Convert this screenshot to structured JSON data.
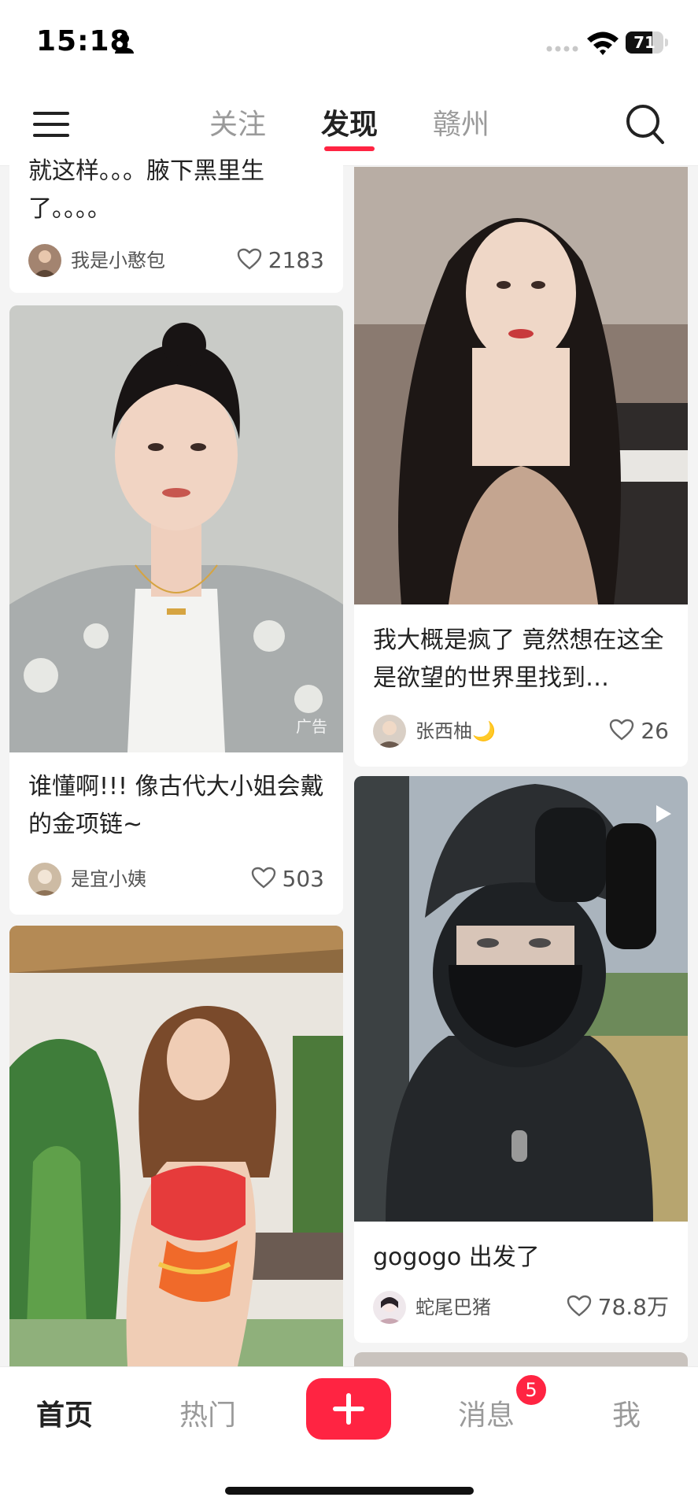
{
  "status_bar": {
    "time": "15:18",
    "battery": "71",
    "battery_level": 0.71
  },
  "top_nav": {
    "tabs": [
      {
        "label": "关注",
        "active": false
      },
      {
        "label": "发现",
        "active": true
      },
      {
        "label": "赣州",
        "active": false
      }
    ]
  },
  "feed": {
    "cards": [
      {
        "title": "就这样。。。腋下黑里生了。。。。",
        "author": "我是小憨包",
        "likes": "2183"
      },
      {
        "title": "我大概是疯了 竟然想在这全是欲望的世界里找到…",
        "author": "张西柚🌙",
        "likes": "26"
      },
      {
        "title": "谁懂啊!!! 像古代大小姐会戴的金项链~",
        "author": "是宜小姨",
        "likes": "503",
        "ad_label": "广告"
      },
      {
        "title": "gogogo 出发了",
        "author": "蛇尾巴猪",
        "likes": "78.8万"
      }
    ]
  },
  "bottom_bar": {
    "tabs": [
      "首页",
      "热门",
      "消息",
      "我"
    ],
    "message_badge": "5"
  },
  "colors": {
    "accent": "#ff2442",
    "background": "#f4f4f4"
  }
}
